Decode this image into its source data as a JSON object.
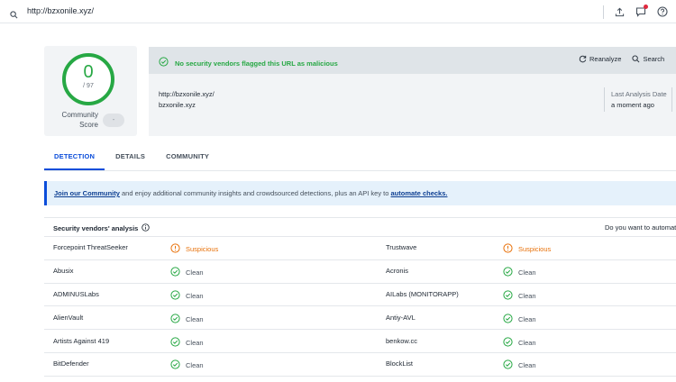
{
  "browser": {
    "url": "http://bzxonile.xyz/"
  },
  "score": {
    "value": "0",
    "total": "/ 97",
    "community_label_line1": "Community",
    "community_label_line2": "Score",
    "community_value": "-"
  },
  "status": {
    "message": "No security vendors flagged this URL as malicious",
    "reanalyze_label": "Reanalyze",
    "search_label": "Search"
  },
  "meta": {
    "url": "http://bzxonile.xyz/",
    "domain": "bzxonile.xyz",
    "last_analysis_label": "Last Analysis Date",
    "last_analysis_value": "a moment ago"
  },
  "tabs": [
    {
      "label": "DETECTION"
    },
    {
      "label": "DETAILS"
    },
    {
      "label": "COMMUNITY"
    }
  ],
  "banner": {
    "link1": "Join our Community",
    "text": " and enjoy additional community insights and crowdsourced detections, plus an API key to ",
    "link2": "automate checks."
  },
  "vendors": {
    "title": "Security vendors' analysis",
    "right_text": "Do you want to automat",
    "rows": [
      {
        "n1": "Forcepoint ThreatSeeker",
        "r1": "Suspicious",
        "n2": "Trustwave",
        "r2": "Suspicious"
      },
      {
        "n1": "Abusix",
        "r1": "Clean",
        "n2": "Acronis",
        "r2": "Clean"
      },
      {
        "n1": "ADMINUSLabs",
        "r1": "Clean",
        "n2": "AILabs (MONITORAPP)",
        "r2": "Clean"
      },
      {
        "n1": "AlienVault",
        "r1": "Clean",
        "n2": "Antiy-AVL",
        "r2": "Clean"
      },
      {
        "n1": "Artists Against 419",
        "r1": "Clean",
        "n2": "benkow.cc",
        "r2": "Clean"
      },
      {
        "n1": "BitDefender",
        "r1": "Clean",
        "n2": "BlockList",
        "r2": "Clean"
      }
    ]
  },
  "colors": {
    "clean": "#27a844",
    "suspicious": "#e8710a",
    "accent": "#0b4dda"
  }
}
